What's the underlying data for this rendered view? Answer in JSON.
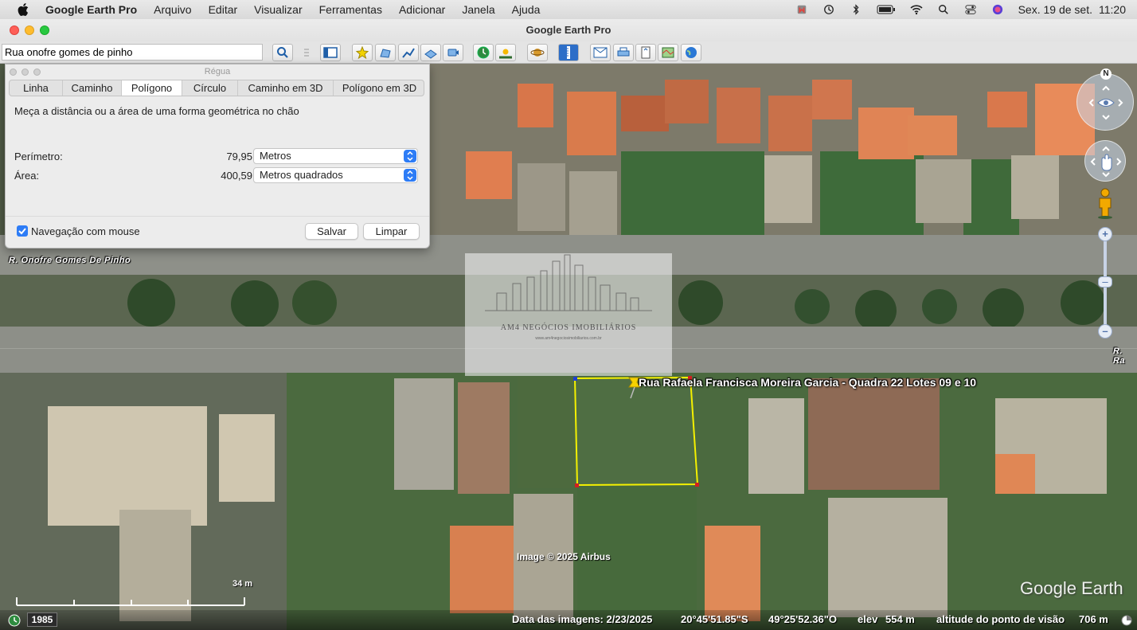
{
  "menubar": {
    "app_name": "Google Earth Pro",
    "items": [
      "Arquivo",
      "Editar",
      "Visualizar",
      "Ferramentas",
      "Adicionar",
      "Janela",
      "Ajuda"
    ],
    "clock_date": "Sex. 19 de set.",
    "clock_time": "11:20"
  },
  "window": {
    "title": "Google Earth Pro"
  },
  "toolbar": {
    "search_value": "Rua onofre gomes de pinho"
  },
  "ruler": {
    "title": "Régua",
    "tabs": [
      "Linha",
      "Caminho",
      "Polígono",
      "Círculo",
      "Caminho em 3D",
      "Polígono em 3D"
    ],
    "active_tab": "Polígono",
    "description": "Meça a distância ou a área de uma forma geométrica no chão",
    "perimeter_label": "Perímetro:",
    "perimeter_value": "79,95",
    "perimeter_unit": "Metros",
    "area_label": "Área:",
    "area_value": "400,59",
    "area_unit": "Metros quadrados",
    "nav_mouse_label": "Navegação com mouse",
    "nav_mouse_checked": true,
    "save_label": "Salvar",
    "clear_label": "Limpar"
  },
  "map": {
    "road_label_top": "R. Onofre Gomes De Pinho",
    "road_label_right": "R. Ra",
    "placemark_label": "Rua Rafaela Francisca Moreira Garcia - Quadra 22 Lotes 09 e 10",
    "watermark_title": "AM4 NEGÓCIOS IMOBILIÁRIOS",
    "watermark_url": "www.am4negociosimobiliarios.com.br",
    "credit": "Image © 2025 Airbus",
    "logo": "Google Earth",
    "scale_label": "34 m",
    "compass_north": "N",
    "polygon_color": "#f4f000"
  },
  "statusbar": {
    "year": "1985",
    "imagery_date": "Data das imagens: 2/23/2025",
    "lat": "20°45'51.85\"S",
    "lon": "49°25'52.36\"O",
    "elev_label": "elev",
    "elev_value": "554 m",
    "eye_label": "altitude do ponto de visão",
    "eye_value": "706 m"
  }
}
